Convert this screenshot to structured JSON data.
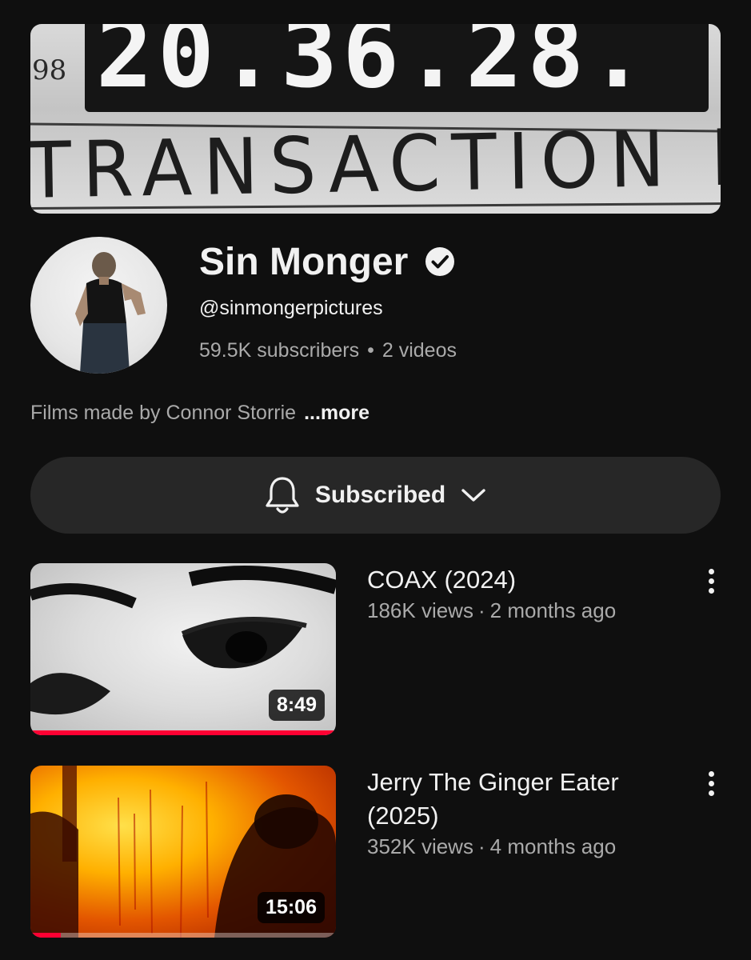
{
  "banner": {
    "side_number": "98",
    "clock_text": "20.36.28.",
    "handwriting_text": "TRANSACTION PLANE"
  },
  "channel": {
    "name": "Sin Monger",
    "verified": true,
    "handle": "@sinmongerpictures",
    "subscribers": "59.5K subscribers",
    "stats_separator": "•",
    "video_count": "2 videos",
    "description": "Films made by Connor Storrie",
    "more_label": "...more"
  },
  "subscribe": {
    "label": "Subscribed",
    "icon_left": "bell-icon",
    "icon_right": "chevron-down-icon"
  },
  "videos": [
    {
      "title": "COAX (2024)",
      "views": "186K views",
      "separator": "·",
      "age": "2 months ago",
      "duration": "8:49",
      "watched_fraction": 1.0
    },
    {
      "title": "Jerry The Ginger Eater (2025)",
      "views": "352K views",
      "separator": "·",
      "age": "4 months ago",
      "duration": "15:06",
      "watched_fraction": 0.1
    }
  ],
  "colors": {
    "background": "#0f0f0f",
    "button_bg": "#272727",
    "text_primary": "#f1f1f1",
    "text_secondary": "#aaaaaa",
    "progress_red": "#ff0033"
  }
}
